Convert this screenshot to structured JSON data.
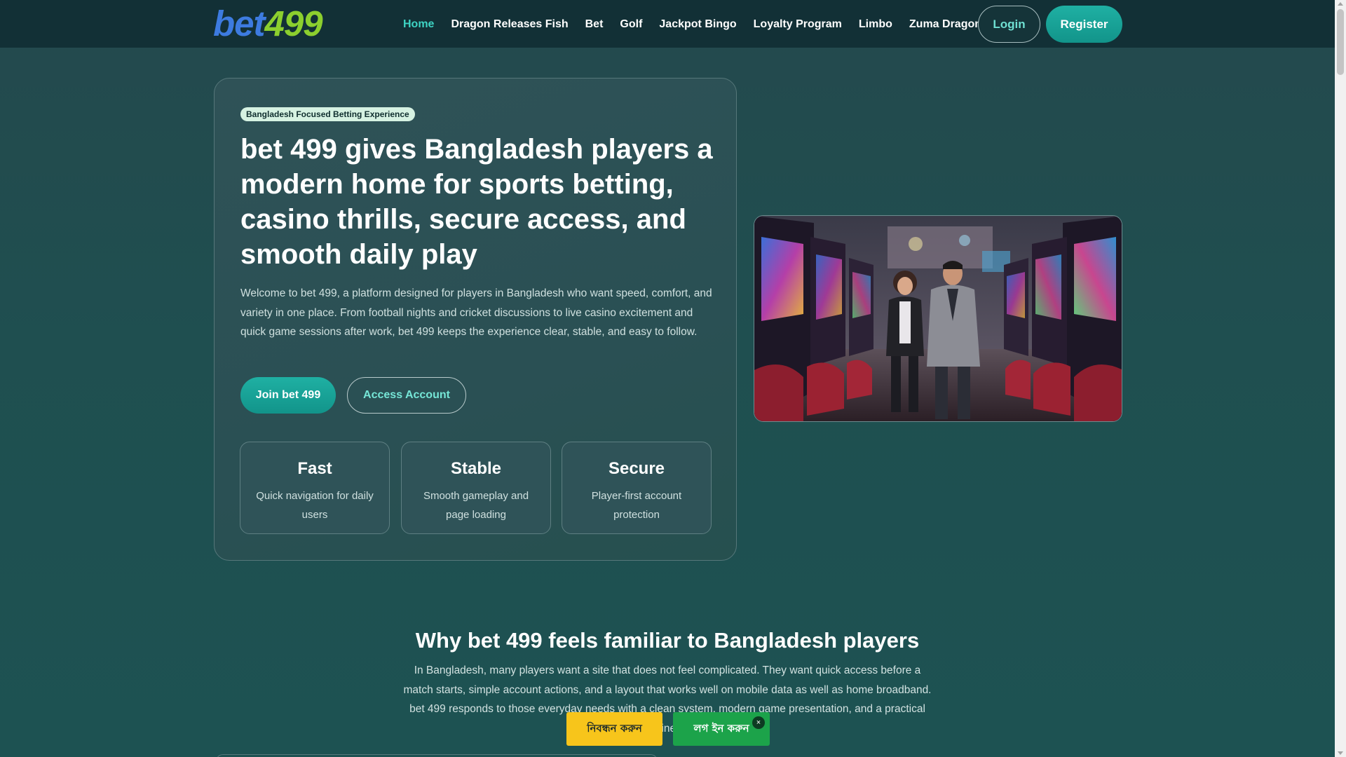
{
  "header": {
    "logo": {
      "part1": "bet",
      "part2": "499"
    },
    "nav": [
      {
        "label": "Home",
        "active": true
      },
      {
        "label": "Dragon Releases Fish",
        "active": false
      },
      {
        "label": "Bet",
        "active": false
      },
      {
        "label": "Golf",
        "active": false
      },
      {
        "label": "Jackpot Bingo",
        "active": false
      },
      {
        "label": "Loyalty Program",
        "active": false
      },
      {
        "label": "Limbo",
        "active": false
      },
      {
        "label": "Zuma Dragon",
        "active": false
      }
    ],
    "login_label": "Login",
    "register_label": "Register"
  },
  "hero": {
    "badge": "Bangladesh Focused Betting Experience",
    "title": "bet 499 gives Bangladesh players a modern home for sports betting, casino thrills, secure access, and smooth daily play",
    "description": "Welcome to bet 499, a platform designed for players in Bangladesh who want speed, comfort, and variety in one place. From football nights and cricket discussions to live casino excitement and quick game sessions after work, bet 499 keeps the experience clear, stable, and easy to follow.",
    "join_label": "Join bet 499",
    "access_label": "Access Account",
    "features": [
      {
        "title": "Fast",
        "desc": "Quick navigation for daily users"
      },
      {
        "title": "Stable",
        "desc": "Smooth gameplay and page loading"
      },
      {
        "title": "Secure",
        "desc": "Player-first account protection"
      }
    ]
  },
  "section2": {
    "title": "Why bet 499 feels familiar to Bangladesh players",
    "text": "In Bangladesh, many players want a site that does not feel complicated. They want quick access before a match starts, simple account actions, and a layout that works well on mobile data as well as home broadband. bet 499 responds to those everyday needs with a clean system, modern game presentation, and a practical approach to online entertainment."
  },
  "floating_bar": {
    "register_label": "নিবন্ধন করুন",
    "login_label": "লগ ইন করুন",
    "close_label": "×"
  },
  "colors": {
    "accent": "#1fb0a3",
    "active_nav": "#3ed4c4",
    "logo_bet": "#3d7be0",
    "logo_499": "#8ccf2e",
    "float_register": "#f7c51b",
    "float_login": "#1ca34a"
  }
}
